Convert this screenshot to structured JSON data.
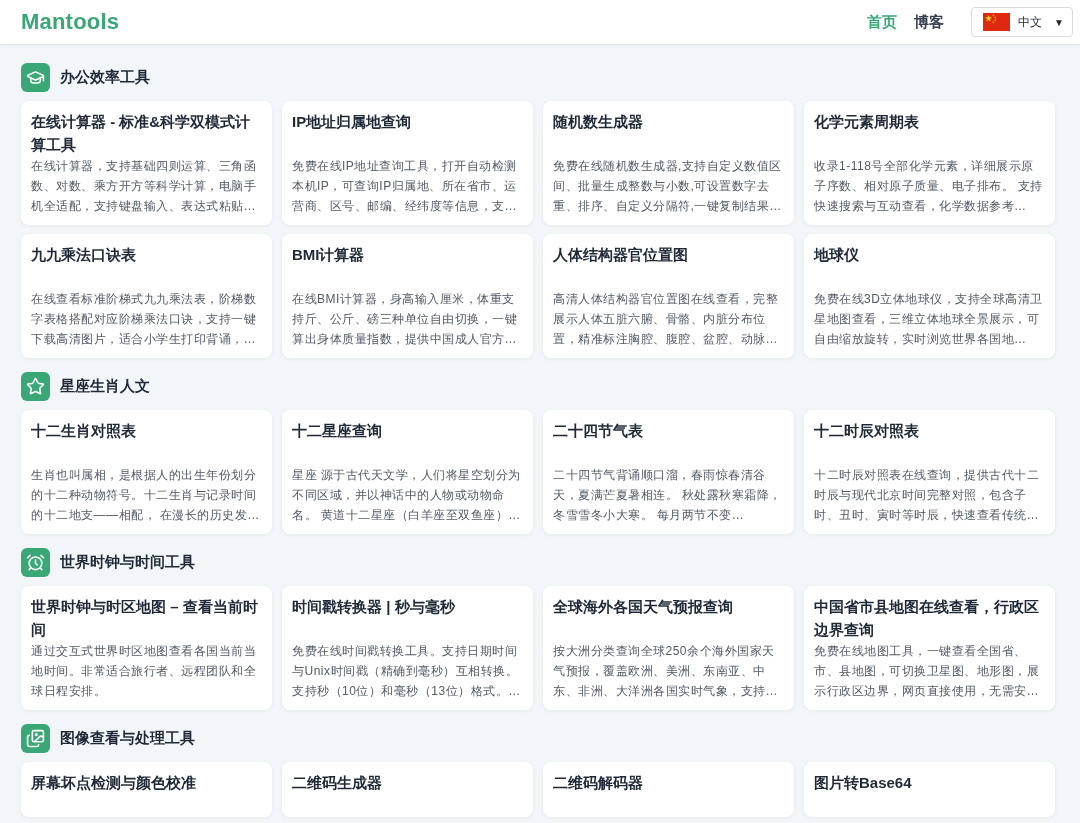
{
  "header": {
    "logo": "Mantools",
    "nav": [
      {
        "label": "首页",
        "selected": true
      },
      {
        "label": "博客",
        "selected": false
      }
    ],
    "language": {
      "label": "中文",
      "caret": "▼"
    }
  },
  "sections": [
    {
      "kind": "education",
      "title": "办公效率工具",
      "tools": [
        {
          "title": "在线计算器 - 标准&科学双模式计算工具",
          "description": "在线计算器，支持基础四则运算、三角函数、对数、乘方开方等科学计算，电脑手机全适配，支持键盘输入、表达式粘贴…"
        },
        {
          "title": "IP地址归属地查询",
          "description": "免费在线IP地址查询工具，打开自动检测本机IP，可查询IP归属地、所在省市、运营商、区号、邮编、经纬度等信息，支…"
        },
        {
          "title": "随机数生成器",
          "description": "免费在线随机数生成器,支持自定义数值区间、批量生成整数与小数,可设置数字去重、排序、自定义分隔符,一键复制结果…"
        },
        {
          "title": "化学元素周期表",
          "description": "收录1-118号全部化学元素，详细展示原子序数、相对原子质量、电子排布。 支持快速搜索与互动查看，化学数据参考…"
        },
        {
          "title": "九九乘法口诀表",
          "description": "在线查看标准阶梯式九九乘法表，阶梯数字表格搭配对应阶梯乘法口诀，支持一键下载高清图片，适合小学生打印背诵，…"
        },
        {
          "title": "BMI计算器",
          "description": "在线BMI计算器，身高输入厘米，体重支持斤、公斤、磅三种单位自由切换，一键算出身体质量指数，提供中国成人官方…"
        },
        {
          "title": "人体结构器官位置图",
          "description": "高清人体结构器官位置图在线查看，完整展示人体五脏六腑、骨骼、内脏分布位置，精准标注胸腔、腹腔、盆腔、动脉…"
        },
        {
          "title": "地球仪",
          "description": "免费在线3D立体地球仪，支持全球高清卫星地图查看，三维立体地球全景展示，可自由缩放旋转，实时浏览世界各国地…"
        }
      ]
    },
    {
      "kind": "star",
      "title": "星座生肖人文",
      "tools": [
        {
          "title": "十二生肖对照表",
          "description": "生肖也叫属相，是根据人的出生年份划分的十二种动物符号。十二生肖与记录时间的十二地支——相配， 在漫长的历史发…"
        },
        {
          "title": "十二星座查询",
          "description": "星座 源于古代天文学，人们将星空划分为不同区域，并以神话中的人物或动物命名。 黄道十二星座（白羊座至双鱼座）…"
        },
        {
          "title": "二十四节气表",
          "description": "二十四节气背诵顺口溜，春雨惊春清谷天，夏满芒夏暑相连。 秋处露秋寒霜降，冬雪雪冬小大寒。 每月两节不变…"
        },
        {
          "title": "十二时辰对照表",
          "description": "十二时辰对照表在线查询，提供古代十二时辰与现代北京时间完整对照，包含子时、丑时、寅时等时辰，快速查看传统…"
        }
      ]
    },
    {
      "kind": "clock",
      "title": "世界时钟与时间工具",
      "tools": [
        {
          "title": "世界时钟与时区地图 – 查看当前时间",
          "description": "通过交互式世界时区地图查看各国当前当地时间。非常适合旅行者、远程团队和全球日程安排。"
        },
        {
          "title": "时间戳转换器 | 秒与毫秒",
          "description": "免费在线时间戳转换工具。支持日期时间与Unix时间戳（精确到毫秒）互相转换。支持秒（10位）和毫秒（13位）格式。…"
        },
        {
          "title": "全球海外各国天气预报查询",
          "description": "按大洲分类查询全球250余个海外国家天气预报，覆盖欧洲、美洲、东南亚、中东、非洲、大洋洲各国实时气象，支持…"
        },
        {
          "title": "中国省市县地图在线查看，行政区边界查询",
          "description": "免费在线地图工具，一键查看全国省、市、县地图，可切换卫星图、地形图，展示行政区边界，网页直接使用，无需安…"
        }
      ]
    },
    {
      "kind": "images",
      "title": "图像查看与处理工具",
      "tools": [
        {
          "title": "屏幕坏点检测与颜色校准"
        },
        {
          "title": "二维码生成器"
        },
        {
          "title": "二维码解码器"
        },
        {
          "title": "图片转Base64"
        }
      ]
    }
  ]
}
